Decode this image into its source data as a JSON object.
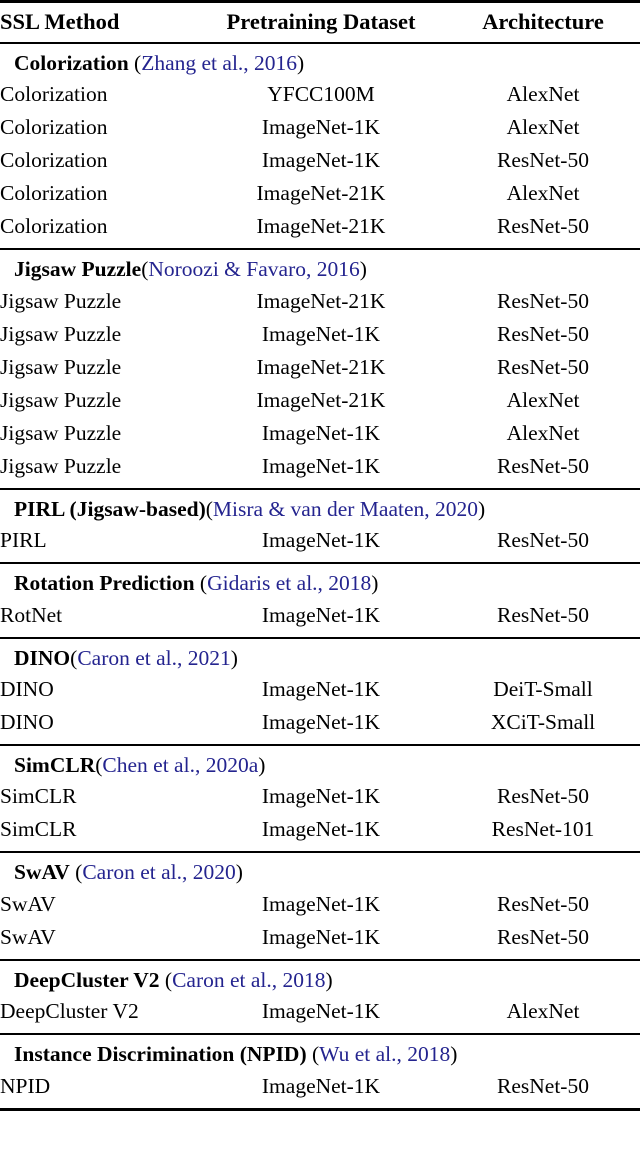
{
  "table": {
    "columns": [
      "SSL Method",
      "Pretraining Dataset",
      "Architecture"
    ],
    "citation_color": "#24248f",
    "sections": [
      {
        "heading_name": "Colorization",
        "heading_sep": " ",
        "heading_open_paren": "(",
        "heading_citation": "Zhang et al., 2016",
        "heading_close_paren": ")",
        "rows": [
          {
            "method": "Colorization",
            "dataset": "YFCC100M",
            "architecture": "AlexNet"
          },
          {
            "method": "Colorization",
            "dataset": "ImageNet-1K",
            "architecture": "AlexNet"
          },
          {
            "method": "Colorization",
            "dataset": "ImageNet-1K",
            "architecture": "ResNet-50"
          },
          {
            "method": "Colorization",
            "dataset": "ImageNet-21K",
            "architecture": "AlexNet"
          },
          {
            "method": "Colorization",
            "dataset": "ImageNet-21K",
            "architecture": "ResNet-50"
          }
        ]
      },
      {
        "heading_name": "Jigsaw Puzzle",
        "heading_sep": "",
        "heading_open_paren": "(",
        "heading_citation": "Noroozi & Favaro, 2016",
        "heading_close_paren": ")",
        "rows": [
          {
            "method": "Jigsaw Puzzle",
            "dataset": "ImageNet-21K",
            "architecture": "ResNet-50"
          },
          {
            "method": "Jigsaw Puzzle",
            "dataset": "ImageNet-1K",
            "architecture": "ResNet-50"
          },
          {
            "method": "Jigsaw Puzzle",
            "dataset": "ImageNet-21K",
            "architecture": "ResNet-50"
          },
          {
            "method": "Jigsaw Puzzle",
            "dataset": "ImageNet-21K",
            "architecture": "AlexNet"
          },
          {
            "method": "Jigsaw Puzzle",
            "dataset": "ImageNet-1K",
            "architecture": "AlexNet"
          },
          {
            "method": "Jigsaw Puzzle",
            "dataset": "ImageNet-1K",
            "architecture": "ResNet-50"
          }
        ]
      },
      {
        "heading_name": "PIRL (Jigsaw-based)",
        "heading_sep": "",
        "heading_open_paren": "(",
        "heading_citation": "Misra & van der Maaten, 2020",
        "heading_close_paren": ")",
        "rows": [
          {
            "method": "PIRL",
            "dataset": "ImageNet-1K",
            "architecture": "ResNet-50"
          }
        ]
      },
      {
        "heading_name": "Rotation Prediction",
        "heading_sep": " ",
        "heading_open_paren": "(",
        "heading_citation": "Gidaris et al., 2018",
        "heading_close_paren": ")",
        "rows": [
          {
            "method": "RotNet",
            "dataset": "ImageNet-1K",
            "architecture": "ResNet-50"
          }
        ]
      },
      {
        "heading_name": "DINO",
        "heading_sep": "",
        "heading_open_paren": "(",
        "heading_citation": "Caron et al., 2021",
        "heading_close_paren": ")",
        "rows": [
          {
            "method": "DINO",
            "dataset": "ImageNet-1K",
            "architecture": "DeiT-Small"
          },
          {
            "method": "DINO",
            "dataset": "ImageNet-1K",
            "architecture": "XCiT-Small"
          }
        ]
      },
      {
        "heading_name": "SimCLR",
        "heading_sep": "",
        "heading_open_paren": "(",
        "heading_citation": "Chen et al., 2020a",
        "heading_close_paren": ")",
        "rows": [
          {
            "method": "SimCLR",
            "dataset": "ImageNet-1K",
            "architecture": "ResNet-50"
          },
          {
            "method": "SimCLR",
            "dataset": "ImageNet-1K",
            "architecture": "ResNet-101"
          }
        ]
      },
      {
        "heading_name": "SwAV",
        "heading_sep": " ",
        "heading_open_paren": "(",
        "heading_citation": "Caron et al., 2020",
        "heading_close_paren": ")",
        "rows": [
          {
            "method": "SwAV",
            "dataset": "ImageNet-1K",
            "architecture": "ResNet-50"
          },
          {
            "method": "SwAV",
            "dataset": "ImageNet-1K",
            "architecture": "ResNet-50"
          }
        ]
      },
      {
        "heading_name": "DeepCluster V2",
        "heading_sep": " ",
        "heading_open_paren": "(",
        "heading_citation": "Caron et al., 2018",
        "heading_close_paren": ")",
        "rows": [
          {
            "method": "DeepCluster V2",
            "dataset": "ImageNet-1K",
            "architecture": "AlexNet"
          }
        ]
      },
      {
        "heading_name": "Instance Discrimination (NPID)",
        "heading_sep": " ",
        "heading_open_paren": "(",
        "heading_citation": "Wu et al., 2018",
        "heading_close_paren": ")",
        "rows": [
          {
            "method": "NPID",
            "dataset": "ImageNet-1K",
            "architecture": "ResNet-50"
          }
        ]
      }
    ]
  }
}
